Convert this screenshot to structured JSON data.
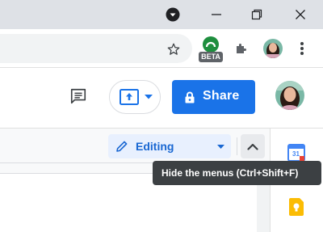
{
  "window": {
    "controls": [
      "minimize-icon",
      "restore-icon",
      "close-icon"
    ],
    "profile_menu_icon": "dropdown-circle-icon"
  },
  "browser_toolbar": {
    "bookmark_icon": "star-icon",
    "extension_badge": "BETA",
    "extensions_icon": "puzzle-icon",
    "menu_icon": "kebab-menu-icon"
  },
  "doc_header": {
    "comments_icon": "comment-history-icon",
    "present_icon": "present-to-meeting-icon",
    "share_label": "Share",
    "share_icon": "lock-icon"
  },
  "doc_toolbar": {
    "mode_label": "Editing",
    "mode_icon": "pencil-icon",
    "hide_menus_icon": "chevron-up-icon"
  },
  "tooltip": {
    "text": "Hide the menus (Ctrl+Shift+F)"
  },
  "side_panel": {
    "apps": [
      "calendar-app-icon",
      "keep-app-icon"
    ],
    "calendar_day": "31"
  },
  "colors": {
    "accent": "#1a73e8",
    "editing_bg": "#e8f0fe",
    "tooltip_bg": "#3c4043",
    "titlebar": "#dee1e6"
  }
}
